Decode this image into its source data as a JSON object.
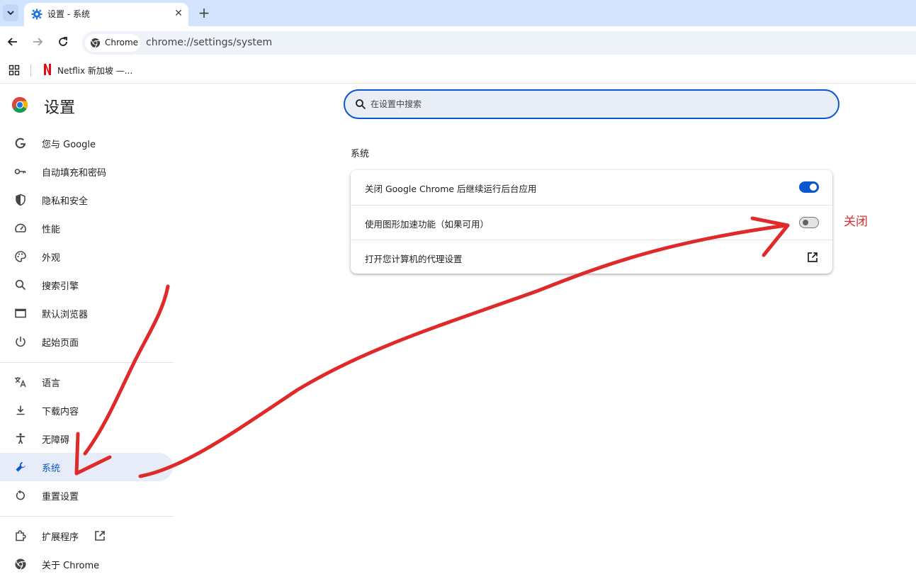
{
  "tab": {
    "title": "设置 - 系统",
    "close": "✕",
    "new_tab": "+"
  },
  "toolbar": {
    "chip_label": "Chrome",
    "url": "chrome://settings/system"
  },
  "bookmarks": {
    "items": [
      {
        "label": "Netflix 新加坡 —..."
      }
    ]
  },
  "header": {
    "title": "设置",
    "search_placeholder": "在设置中搜索"
  },
  "sidebar": {
    "items": [
      {
        "label": "您与 Google",
        "icon": "google-icon"
      },
      {
        "label": "自动填充和密码",
        "icon": "key-icon"
      },
      {
        "label": "隐私和安全",
        "icon": "shield-icon"
      },
      {
        "label": "性能",
        "icon": "speedometer-icon"
      },
      {
        "label": "外观",
        "icon": "palette-icon"
      },
      {
        "label": "搜索引擎",
        "icon": "search-icon"
      },
      {
        "label": "默认浏览器",
        "icon": "browser-icon"
      },
      {
        "label": "起始页面",
        "icon": "power-icon"
      },
      {
        "label": "语言",
        "icon": "translate-icon"
      },
      {
        "label": "下载内容",
        "icon": "download-icon"
      },
      {
        "label": "无障碍",
        "icon": "accessibility-icon"
      },
      {
        "label": "系统",
        "icon": "wrench-icon",
        "active": true
      },
      {
        "label": "重置设置",
        "icon": "reset-icon"
      },
      {
        "label": "扩展程序",
        "icon": "extension-icon"
      },
      {
        "label": "关于 Chrome",
        "icon": "chrome-icon"
      }
    ]
  },
  "main": {
    "section_title": "系统",
    "rows": [
      {
        "label": "关闭 Google Chrome 后继续运行后台应用",
        "control": "toggle",
        "on": true
      },
      {
        "label": "使用图形加速功能（如果可用）",
        "control": "toggle",
        "on": false
      },
      {
        "label": "打开您计算机的代理设置",
        "control": "open-external-icon"
      }
    ]
  },
  "annotation": {
    "label": "关闭",
    "color": "#e02a2a"
  },
  "colors": {
    "accent": "#0b57d0",
    "tabstrip": "#d3e3fd",
    "active_nav_bg": "#e6edf9"
  }
}
